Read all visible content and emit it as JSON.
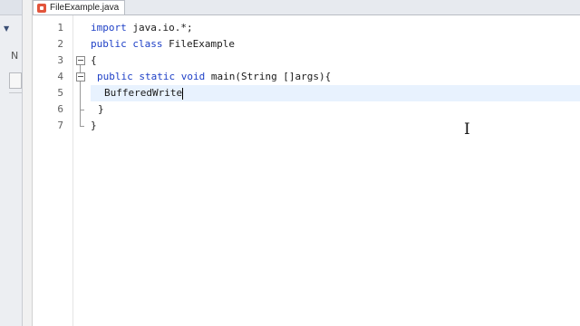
{
  "tab": {
    "label": "FileExample.java",
    "icon": "java-file-icon"
  },
  "side_panel": {
    "letter": "N"
  },
  "editor": {
    "line_numbers": [
      "1",
      "2",
      "3",
      "4",
      "5",
      "6",
      "7"
    ],
    "lines": [
      {
        "kw": "import",
        "text": " java.io.*;"
      },
      {
        "kw": "public class",
        "text": " FileExample"
      },
      {
        "kw": "",
        "text": "{"
      },
      {
        "kw": "public static void",
        "text": " main(String []args){"
      },
      {
        "kw": "",
        "text": "BufferedWrite"
      },
      {
        "kw": "",
        "text": "}"
      },
      {
        "kw": "",
        "text": "}"
      }
    ],
    "current_line": 5
  },
  "colors": {
    "keyword": "#1d3fc6",
    "current_line_bg": "#e8f2fe",
    "tab_icon": "#e2553c"
  }
}
